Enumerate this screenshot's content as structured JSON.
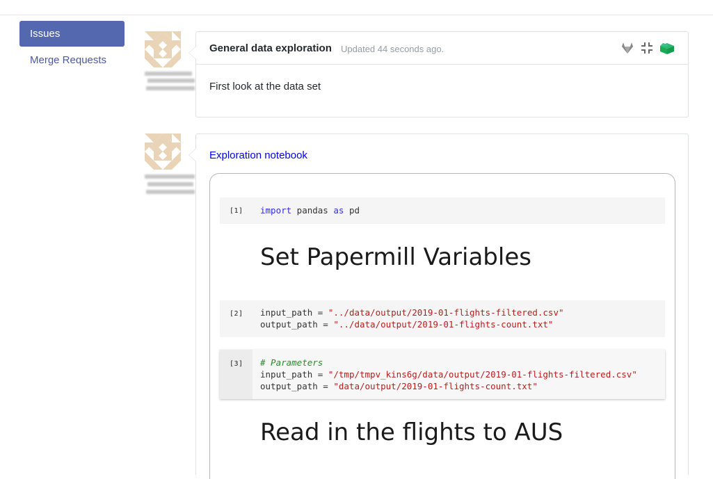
{
  "sidebar": {
    "items": [
      {
        "label": "Issues",
        "active": true
      },
      {
        "label": "Merge Requests",
        "active": false
      }
    ]
  },
  "issue_card": {
    "title": "General data exploration",
    "updated": "Updated 44 seconds ago.",
    "body": "First look at the data set",
    "icons": [
      "gitlab-icon",
      "collapse-icon",
      "open-box-icon"
    ]
  },
  "notebook_card": {
    "link": "Exploration notebook",
    "cells": [
      {
        "prompt": "[1]",
        "tokens": [
          [
            "kw",
            "import"
          ],
          [
            "plain",
            " pandas "
          ],
          [
            "kw",
            "as"
          ],
          [
            "plain",
            " pd"
          ]
        ]
      },
      {
        "markdown": "Set Papermill Variables"
      },
      {
        "prompt": "[2]",
        "lines": [
          [
            [
              "plain",
              "input_path = "
            ],
            [
              "str",
              "\"../data/output/2019-01-flights-filtered.csv\""
            ]
          ],
          [
            [
              "plain",
              "output_path = "
            ],
            [
              "str",
              "\"../data/output/2019-01-flights-count.txt\""
            ]
          ]
        ]
      },
      {
        "prompt": "[3]",
        "lines": [
          [
            [
              "cm",
              "# Parameters"
            ]
          ],
          [
            [
              "plain",
              "input_path = "
            ],
            [
              "str",
              "\"/tmp/tmpv_kins6g/data/output/2019-01-flights-filtered.csv\""
            ]
          ],
          [
            [
              "plain",
              "output_path = "
            ],
            [
              "str",
              "\"data/output/2019-01-flights-count.txt\""
            ]
          ]
        ]
      },
      {
        "markdown": "Read in the flights to AUS"
      }
    ]
  },
  "colors": {
    "accent": "#5468b0",
    "link": "#0000ee",
    "keyword": "#2f2fdf",
    "string": "#b81d1d",
    "comment": "#2a8a2a",
    "green_icon": "#1aaa55"
  }
}
